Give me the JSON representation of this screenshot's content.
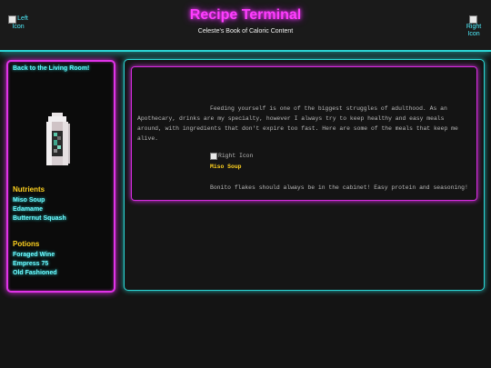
{
  "header": {
    "title": "Recipe Terminal",
    "subtitle": "Celeste's Book of Caloric Content",
    "left_icon_alt": "Left Icon",
    "right_icon_alt": "Right Icon"
  },
  "sidebar": {
    "back_link": "Back to the Living Room!",
    "avatar_icon": "pixel-character",
    "nutrients_heading": "Nutrients",
    "nutrients": [
      "Miso Soup",
      "Edamame",
      "Butternut Squash"
    ],
    "potions_heading": "Potions",
    "potions": [
      "Foraged Wine",
      "Empress 75",
      "Old Fashioned"
    ]
  },
  "main": {
    "intro": "Feeding yourself is one of the biggest struggles of adulthood. As an Apothecary, drinks are my specialty, however I always try to keep healthy and easy meals around, with ingredients that don't expire too fast. Here are some of the meals that keep me alive.",
    "recipe_image_alt": "Right Icon",
    "recipe_name": "Miso Soup",
    "recipe_desc": "Bonito flakes should always be in the cabinet! Easy protein and seasoning!"
  },
  "colors": {
    "neon_pink": "#ff3dff",
    "neon_cyan": "#2bd6d6",
    "gold": "#ffd21f",
    "background": "#141414"
  }
}
